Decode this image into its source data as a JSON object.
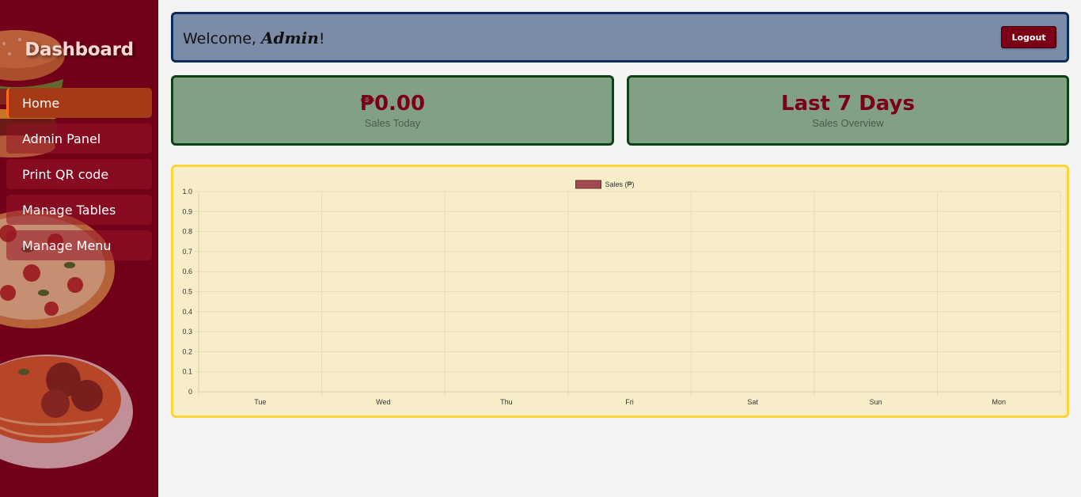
{
  "sidebar": {
    "title": "Dashboard",
    "items": [
      {
        "label": "Home",
        "active": true
      },
      {
        "label": "Admin Panel"
      },
      {
        "label": "Print QR code"
      },
      {
        "label": "Manage Tables"
      },
      {
        "label": "Manage Menu"
      }
    ]
  },
  "header": {
    "welcome_prefix": "Welcome,",
    "user_name": "Admin",
    "welcome_suffix": "!",
    "logout_label": "Logout"
  },
  "cards": [
    {
      "value": "₱0.00",
      "label": "Sales Today"
    },
    {
      "value": "Last 7 Days",
      "label": "Sales Overview"
    }
  ],
  "colors": {
    "sidebar_bg": "#74001a",
    "accent": "#7a0016",
    "welcome_bg": "#7b8ca8",
    "card_bg": "#82a084",
    "chart_bg": "#f7eec9",
    "chart_border": "#ffd43a",
    "series": "#9e4a50"
  },
  "chart_data": {
    "type": "bar",
    "categories": [
      "Tue",
      "Wed",
      "Thu",
      "Fri",
      "Sat",
      "Sun",
      "Mon"
    ],
    "series": [
      {
        "name": "Sales (₱)",
        "values": [
          0,
          0,
          0,
          0,
          0,
          0,
          0
        ]
      }
    ],
    "y_ticks": [
      "1.0",
      "0.9",
      "0.8",
      "0.7",
      "0.6",
      "0.5",
      "0.4",
      "0.3",
      "0.2",
      "0.1",
      "0"
    ],
    "ylim": [
      0,
      1.0
    ],
    "grid": true,
    "legend_position": "top"
  }
}
